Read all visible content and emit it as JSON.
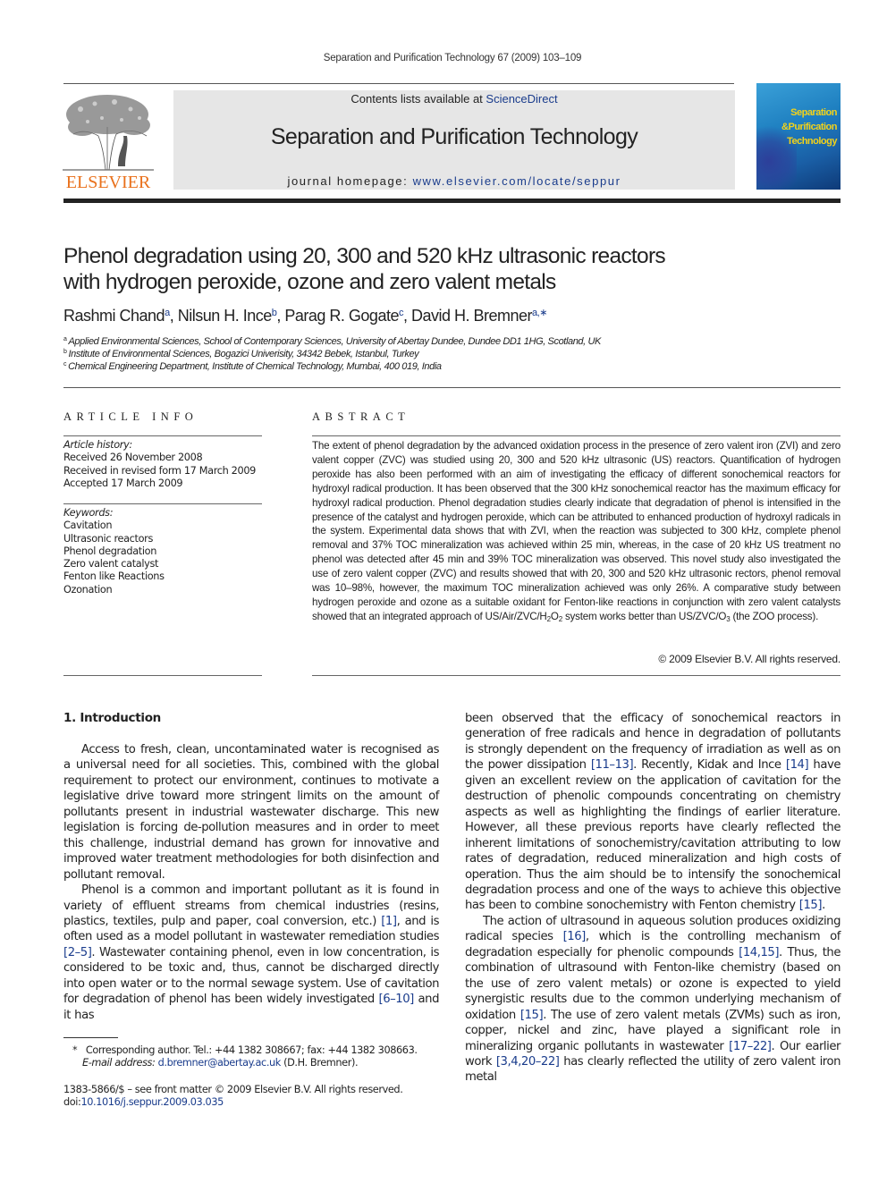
{
  "running_head": "Separation and Purification Technology 67 (2009) 103–109",
  "masthead": {
    "publisher": "ELSEVIER",
    "contents_prefix": "Contents lists available at ",
    "contents_link": "ScienceDirect",
    "journal_title": "Separation and Purification Technology",
    "homepage_prefix": "journal homepage: ",
    "homepage_link": "www.elsevier.com/locate/seppur",
    "cover": {
      "line1": "Separation",
      "line2": "&Purification",
      "line3": "Technology"
    },
    "colors": {
      "publisher_orange": "#e9711c",
      "link_blue": "#1a3c8c",
      "banner_gray": "#e6e6e6",
      "cover_text": "#f2d21a"
    }
  },
  "article": {
    "title_line1": "Phenol degradation using 20, 300 and 520 kHz ultrasonic reactors",
    "title_line2": "with hydrogen peroxide, ozone and zero valent metals",
    "authors": [
      {
        "name": "Rashmi Chand",
        "sup": "a"
      },
      {
        "name": "Nilsun H. Ince",
        "sup": "b"
      },
      {
        "name": "Parag R. Gogate",
        "sup": "c"
      },
      {
        "name": "David H. Bremner",
        "sup": "a,∗"
      }
    ],
    "affiliations": [
      {
        "key": "a",
        "text": "Applied Environmental Sciences, School of Contemporary Sciences, University of Abertay Dundee, Dundee DD1 1HG, Scotland, UK"
      },
      {
        "key": "b",
        "text": "Institute of Environmental Sciences, Bogazici Univerisity, 34342 Bebek, Istanbul, Turkey"
      },
      {
        "key": "c",
        "text": "Chemical Engineering Department, Institute of Chemical Technology, Mumbai, 400 019, India"
      }
    ]
  },
  "article_info": {
    "heading": "ARTICLE INFO",
    "history_label": "Article history:",
    "history": [
      "Received 26 November 2008",
      "Received in revised form 17 March 2009",
      "Accepted 17 March 2009"
    ],
    "keywords_label": "Keywords:",
    "keywords": [
      "Cavitation",
      "Ultrasonic reactors",
      "Phenol degradation",
      "Zero valent catalyst",
      "Fenton like Reactions",
      "Ozonation"
    ]
  },
  "abstract": {
    "heading": "ABSTRACT",
    "text_main": "The extent of phenol degradation by the advanced oxidation process in the presence of zero valent iron (ZVI) and zero valent copper (ZVC) was studied using 20, 300 and 520 kHz ultrasonic (US) reactors. Quantification of hydrogen peroxide has also been performed with an aim of investigating the efficacy of different sonochemical reactors for hydroxyl radical production. It has been observed that the 300 kHz sonochemical reactor has the maximum efficacy for hydroxyl radical production. Phenol degradation studies clearly indicate that degradation of phenol is intensified in the presence of the catalyst and hydrogen peroxide, which can be attributed to enhanced production of hydroxyl radicals in the system. Experimental data shows that with ZVI, when the reaction was subjected to 300 kHz, complete phenol removal and 37% TOC mineralization was achieved within 25 min, whereas, in the case of 20 kHz US treatment no phenol was detected after 45 min and 39% TOC mineralization was observed. This novel study also investigated the use of zero valent copper (ZVC) and results showed that with 20, 300 and 520 kHz ultrasonic rectors, phenol removal was 10–98%, however, the maximum TOC mineralization achieved was only 26%. A comparative study between hydrogen peroxide and ozone as a suitable oxidant for Fenton-like reactions in conjunction with zero valent catalysts showed that an integrated approach of US/Air/ZVC/H",
    "sub1": "2",
    "mid1": "O",
    "sub2": "2",
    "mid2": " system works better than US/ZVC/O",
    "sub3": "3",
    "tail": " (the ZOO process).",
    "copyright": "© 2009 Elsevier B.V. All rights reserved."
  },
  "introduction": {
    "heading": "1.  Introduction",
    "p1": "Access to fresh, clean, uncontaminated water is recognised as a universal need for all societies. This, combined with the global requirement to protect our environment, continues to motivate a legislative drive toward more stringent limits on the amount of pollutants present in industrial wastewater discharge. This new legislation is forcing de-pollution measures and in order to meet this challenge, industrial demand has grown for innovative and improved water treatment methodologies for both disinfection and pollutant removal.",
    "p2": {
      "t1": "Phenol is a common and important pollutant as it is found in variety of effluent streams from chemical industries (resins, plastics, textiles, pulp and paper, coal conversion, etc.) ",
      "r1": "[1]",
      "t2": ", and is often used as a model pollutant in wastewater remediation studies ",
      "r2": "[2–5]",
      "t3": ". Wastewater containing phenol, even in low concentration, is considered to be toxic and, thus, cannot be discharged directly into open water or to the normal sewage system. Use of cavitation for degradation of phenol has been widely investigated ",
      "r3": "[6–10]",
      "t4": " and it has"
    },
    "p3": {
      "t1": "been observed that the efficacy of sonochemical reactors in generation of free radicals and hence in degradation of pollutants is strongly dependent on the frequency of irradiation as well as on the power dissipation ",
      "r1": "[11–13]",
      "t2": ". Recently, Kidak and Ince ",
      "r2": "[14]",
      "t3": " have given an excellent review on the application of cavitation for the destruction of phenolic compounds concentrating on chemistry aspects as well as highlighting the findings of earlier literature. However, all these previous reports have clearly reflected the inherent limitations of sonochemistry/cavitation attributing to low rates of degradation, reduced mineralization and high costs of operation. Thus the aim should be to intensify the sonochemical degradation process and one of the ways to achieve this objective has been to combine sonochemistry with Fenton chemistry ",
      "r3": "[15]",
      "t4": "."
    },
    "p4": {
      "t1": "The action of ultrasound in aqueous solution produces oxidizing radical species ",
      "r1": "[16]",
      "t2": ", which is the controlling mechanism of degradation especially for phenolic compounds ",
      "r2": "[14,15]",
      "t3": ". Thus, the combination of ultrasound with Fenton-like chemistry (based on the use of zero valent metals) or ozone is expected to yield synergistic results due to the common underlying mechanism of oxidation ",
      "r3": "[15]",
      "t4": ". The use of zero valent metals (ZVMs) such as iron, copper, nickel and zinc, have played a significant role in mineralizing organic pollutants in wastewater ",
      "r4": "[17–22]",
      "t5": ". Our earlier work ",
      "r5": "[3,4,20–22]",
      "t6": " has clearly reflected the utility of zero valent iron metal"
    }
  },
  "footnotes": {
    "corr_mark": "*",
    "corr_text": "Corresponding author. Tel.: +44 1382 308667; fax: +44 1382 308663.",
    "email_label": "E-mail address:",
    "email": "d.bremner@abertay.ac.uk",
    "email_suffix": " (D.H. Bremner).",
    "issn_line": "1383-5866/$ – see front matter © 2009 Elsevier B.V. All rights reserved.",
    "doi_prefix": "doi:",
    "doi": "10.1016/j.seppur.2009.03.035"
  }
}
